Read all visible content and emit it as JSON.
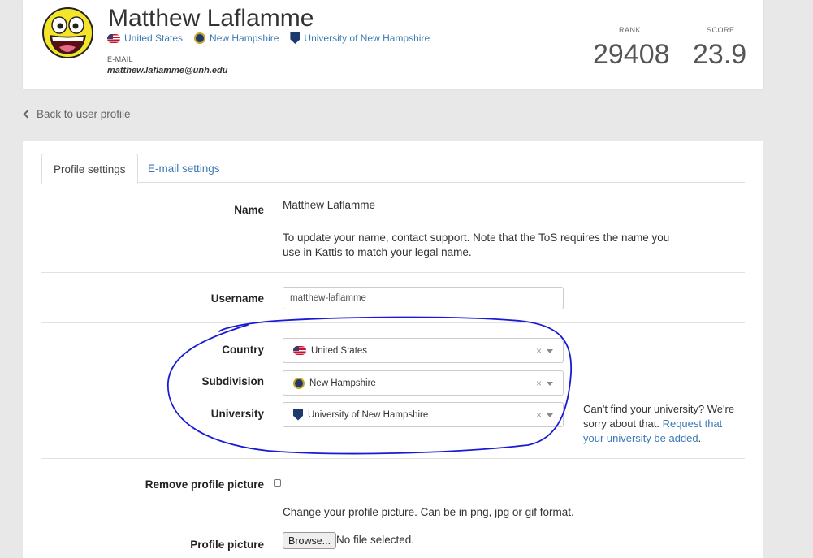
{
  "header": {
    "name": "Matthew Laflamme",
    "country": "United States",
    "subdivision": "New Hampshire",
    "university": "University of New Hampshire",
    "email_label": "E-MAIL",
    "email": "matthew.laflamme@unh.edu",
    "rank_label": "RANK",
    "rank": "29408",
    "score_label": "SCORE",
    "score": "23.9"
  },
  "back_link": "Back to user profile",
  "tabs": [
    {
      "label": "Profile settings",
      "active": true
    },
    {
      "label": "E-mail settings",
      "active": false
    }
  ],
  "form": {
    "name_label": "Name",
    "name_value": "Matthew Laflamme",
    "name_help": "To update your name, contact support. Note that the ToS requires the name you use in Kattis to match your legal name.",
    "username_label": "Username",
    "username_value": "matthew-laflamme",
    "country_label": "Country",
    "country_value": "United States",
    "subdivision_label": "Subdivision",
    "subdivision_value": "New Hampshire",
    "university_label": "University",
    "university_value": "University of New Hampshire",
    "clear_symbol": "×",
    "university_note": "Can't find your university? We're sorry about that.",
    "university_link": "Request that your university be added",
    "university_note_end": ".",
    "remove_picture_label": "Remove profile picture",
    "remove_picture_checked": false,
    "picture_help": "Change your profile picture. Can be in png, jpg or gif format.",
    "picture_label": "Profile picture",
    "browse_label": "Browse...",
    "file_status": "No file selected."
  },
  "colors": {
    "link": "#3b7ab5",
    "annotation": "#1a1ad6",
    "background": "#e8e8e8"
  }
}
